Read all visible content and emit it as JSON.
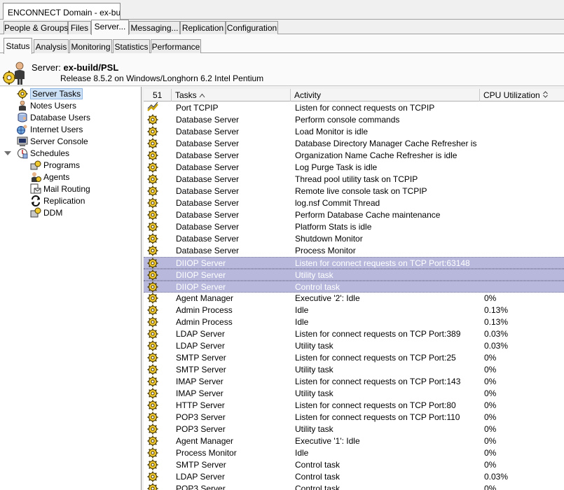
{
  "window": {
    "doc_tab": "ENCONNECT Domain - ex-buil..."
  },
  "main_tabs": [
    "People & Groups",
    "Files",
    "Server...",
    "Messaging...",
    "Replication",
    "Configuration"
  ],
  "sub_tabs": [
    "Status",
    "Analysis",
    "Monitoring",
    "Statistics",
    "Performance"
  ],
  "server": {
    "label": "Server:",
    "name": "ex-build/PSL",
    "release": "Release 8.5.2 on Windows/Longhorn 6.2 Intel Pentium"
  },
  "nav": [
    {
      "label": "Server Tasks",
      "icon": "gear-icon"
    },
    {
      "label": "Notes Users",
      "icon": "user-icon"
    },
    {
      "label": "Database Users",
      "icon": "database-users-icon"
    },
    {
      "label": "Internet Users",
      "icon": "internet-users-icon"
    },
    {
      "label": "Server Console",
      "icon": "console-icon"
    },
    {
      "label": "Schedules",
      "icon": "schedules-icon"
    },
    {
      "label": "Programs",
      "icon": "programs-icon"
    },
    {
      "label": "Agents",
      "icon": "agent-icon"
    },
    {
      "label": "Mail Routing",
      "icon": "mail-routing-icon"
    },
    {
      "label": "Replication",
      "icon": "replication-icon"
    },
    {
      "label": "DDM",
      "icon": "ddm-icon"
    }
  ],
  "grid": {
    "count": "51",
    "columns": {
      "tasks": "Tasks",
      "activity": "Activity",
      "cpu": "CPU Utilization"
    },
    "rows": [
      {
        "task": "Port TCPIP",
        "activity": "Listen for connect requests on TCPIP",
        "cpu": "",
        "icon": "port-icon"
      },
      {
        "task": "Database Server",
        "activity": "Perform console commands",
        "cpu": ""
      },
      {
        "task": "Database Server",
        "activity": "Load Monitor is idle",
        "cpu": ""
      },
      {
        "task": "Database Server",
        "activity": "Database Directory Manager Cache Refresher is",
        "cpu": ""
      },
      {
        "task": "Database Server",
        "activity": "Organization Name Cache Refresher is idle",
        "cpu": ""
      },
      {
        "task": "Database Server",
        "activity": "Log Purge Task is idle",
        "cpu": ""
      },
      {
        "task": "Database Server",
        "activity": "Thread pool utility task on TCPIP",
        "cpu": ""
      },
      {
        "task": "Database Server",
        "activity": "Remote live console task on TCPIP",
        "cpu": ""
      },
      {
        "task": "Database Server",
        "activity": "log.nsf Commit Thread",
        "cpu": ""
      },
      {
        "task": "Database Server",
        "activity": "Perform Database Cache maintenance",
        "cpu": ""
      },
      {
        "task": "Database Server",
        "activity": "Platform Stats is idle",
        "cpu": ""
      },
      {
        "task": "Database Server",
        "activity": "Shutdown Monitor",
        "cpu": ""
      },
      {
        "task": "Database Server",
        "activity": "Process Monitor",
        "cpu": ""
      },
      {
        "task": "DIIOP Server",
        "activity": "Listen for connect requests on TCP Port:63148",
        "cpu": "",
        "selected": true
      },
      {
        "task": "DIIOP Server",
        "activity": "Utility task",
        "cpu": "",
        "selected": true
      },
      {
        "task": "DIIOP Server",
        "activity": "Control task",
        "cpu": "",
        "selected": true
      },
      {
        "task": "Agent Manager",
        "activity": "Executive '2': Idle",
        "cpu": "0%"
      },
      {
        "task": "Admin Process",
        "activity": "Idle",
        "cpu": "0.13%"
      },
      {
        "task": "Admin Process",
        "activity": "Idle",
        "cpu": "0.13%"
      },
      {
        "task": "LDAP Server",
        "activity": "Listen for connect requests on TCP Port:389",
        "cpu": "0.03%"
      },
      {
        "task": "LDAP Server",
        "activity": "Utility task",
        "cpu": "0.03%"
      },
      {
        "task": "SMTP Server",
        "activity": "Listen for connect requests on TCP Port:25",
        "cpu": "0%"
      },
      {
        "task": "SMTP Server",
        "activity": "Utility task",
        "cpu": "0%"
      },
      {
        "task": "IMAP Server",
        "activity": "Listen for connect requests on TCP Port:143",
        "cpu": "0%"
      },
      {
        "task": "IMAP Server",
        "activity": "Utility task",
        "cpu": "0%"
      },
      {
        "task": "HTTP Server",
        "activity": "Listen for connect requests on TCP Port:80",
        "cpu": "0%"
      },
      {
        "task": "POP3 Server",
        "activity": "Listen for connect requests on TCP Port:110",
        "cpu": "0%"
      },
      {
        "task": "POP3 Server",
        "activity": "Utility task",
        "cpu": "0%"
      },
      {
        "task": "Agent Manager",
        "activity": "Executive '1': Idle",
        "cpu": "0%"
      },
      {
        "task": "Process Monitor",
        "activity": "Idle",
        "cpu": "0%"
      },
      {
        "task": "SMTP Server",
        "activity": "Control task",
        "cpu": "0%"
      },
      {
        "task": "LDAP Server",
        "activity": "Control task",
        "cpu": "0.03%"
      },
      {
        "task": "POP3 Server",
        "activity": "Control task",
        "cpu": "0%"
      }
    ]
  },
  "colors": {
    "selection": "#b7b8dc",
    "nav_selection": "#cde1f7",
    "gear": "#e8c020"
  }
}
